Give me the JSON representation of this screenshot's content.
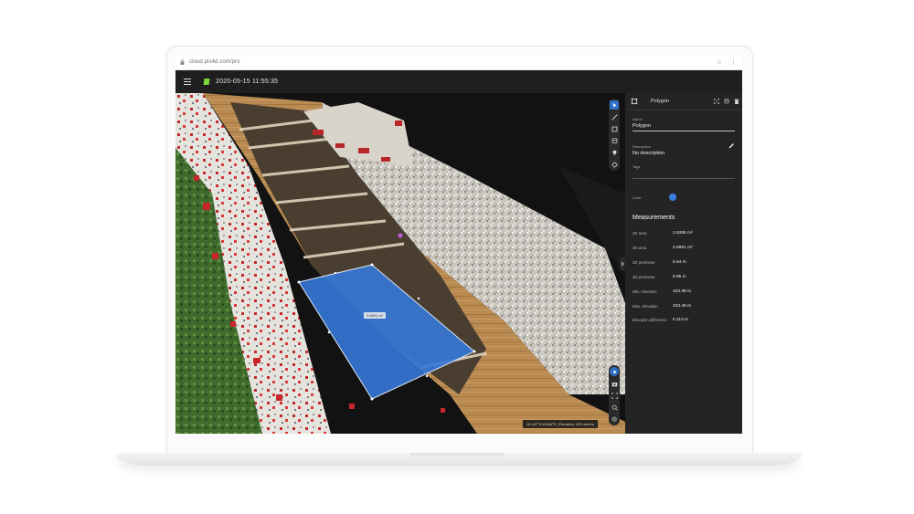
{
  "browser": {
    "url": "cloud.pix4d.com/pro",
    "icons": [
      "star-icon",
      "more-vert-icon"
    ]
  },
  "app": {
    "project_title": "2020-05-15 11:55:35",
    "menu_icon": "hamburger-icon",
    "project_icon": "project-badge-icon"
  },
  "viewport": {
    "area_tag": "2.6891 m²",
    "status_readout": "46.447°N 8.586°E  |  Elevation: 433 meters",
    "tools_top": [
      "select-cursor-icon",
      "line-measure-icon",
      "polygon-tool-icon",
      "volume-icon",
      "marker-icon",
      "reset-view-icon"
    ],
    "tools_bottom": [
      "view-mode-icon",
      "camera-icon",
      "fit-view-icon",
      "zoom-in-icon",
      "zoom-out-icon"
    ]
  },
  "panel": {
    "header_title": "Polygon",
    "header_actions": [
      "fit-icon",
      "database-icon",
      "delete-icon"
    ],
    "name_label": "Name",
    "name_value": "Polygon",
    "description_label": "Description",
    "description_value": "No description",
    "tags_label": "Tags",
    "color_label": "Color",
    "color_value": "#3b7de0",
    "measurements_title": "Measurements",
    "measurements": [
      {
        "label": "2D area",
        "value": "2.6395 m²"
      },
      {
        "label": "3D area",
        "value": "2.6891 m²"
      },
      {
        "label": "2D perimeter",
        "value": "6.94 m"
      },
      {
        "label": "3D perimeter",
        "value": "6.95 m"
      },
      {
        "label": "Min. elevation",
        "value": "433.38 m"
      },
      {
        "label": "Max. elevation",
        "value": "433.49 m"
      },
      {
        "label": "Elevation difference",
        "value": "0.110 m"
      }
    ]
  }
}
